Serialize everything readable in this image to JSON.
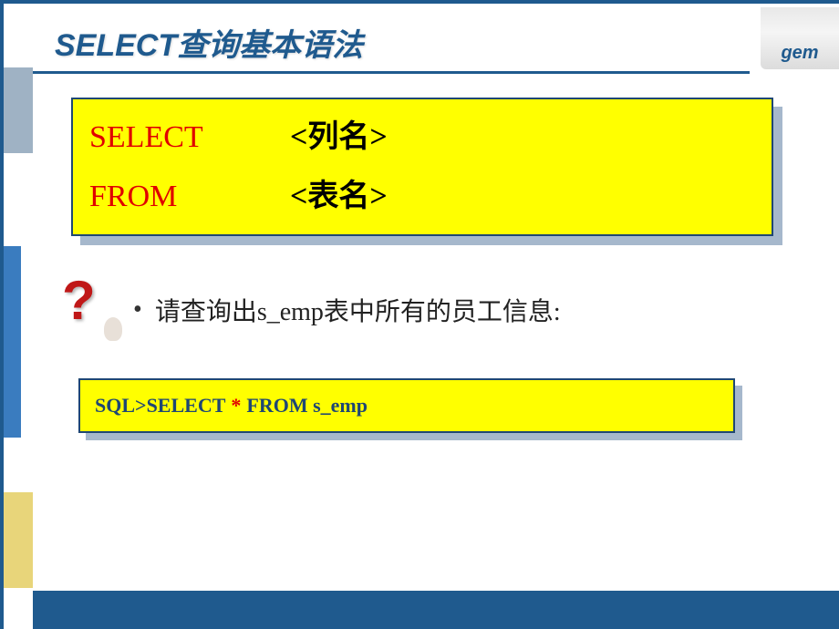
{
  "logo": {
    "text": "gem"
  },
  "title": "SELECT查询基本语法",
  "syntax": {
    "line1_kw": "SELECT",
    "line1_arg": "<列名>",
    "line2_kw": "FROM",
    "line2_arg": "<表名>"
  },
  "question": {
    "bullet": "•",
    "text": "请查询出s_emp表中所有的员工信息:"
  },
  "sql": {
    "prompt": "SQL> ",
    "part1": " SELECT ",
    "star": " * ",
    "part2": " FROM  s_emp"
  }
}
